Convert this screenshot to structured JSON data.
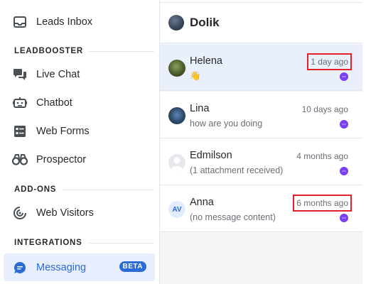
{
  "sidebar": {
    "top_item": {
      "label": "Leads Inbox",
      "icon": "inbox-icon"
    },
    "sections": [
      {
        "heading": "LEADBOOSTER"
      },
      {
        "heading": "ADD-ONS"
      },
      {
        "heading": "INTEGRATIONS"
      }
    ],
    "items": [
      {
        "label": "Live Chat",
        "icon": "chat-bubbles-icon"
      },
      {
        "label": "Chatbot",
        "icon": "bot-icon"
      },
      {
        "label": "Web Forms",
        "icon": "form-icon"
      },
      {
        "label": "Prospector",
        "icon": "binoculars-icon"
      },
      {
        "label": "Web Visitors",
        "icon": "target-icon"
      },
      {
        "label": "Messaging",
        "icon": "message-icon",
        "badge": "BETA",
        "active": true
      }
    ]
  },
  "inbox": {
    "title": "Dolik",
    "conversations": [
      {
        "name": "Helena",
        "preview": "👋",
        "time": "1 day ago",
        "highlighted_time": true,
        "selected": true,
        "channel_icon": "messenger-icon"
      },
      {
        "name": "Lina",
        "preview": "how are you doing",
        "time": "10 days ago",
        "highlighted_time": false,
        "selected": false,
        "channel_icon": "messenger-icon"
      },
      {
        "name": "Edmilson",
        "preview": "(1 attachment received)",
        "time": "4 months ago",
        "highlighted_time": false,
        "selected": false,
        "channel_icon": "messenger-icon"
      },
      {
        "name": "Anna",
        "initials": "AV",
        "preview": "(no message content)",
        "time": "6 months ago",
        "highlighted_time": true,
        "selected": false,
        "channel_icon": "messenger-icon"
      }
    ]
  },
  "colors": {
    "accent": "#2b6bd6",
    "active_bg": "#e7efff",
    "selected_row_bg": "#eaf0fb",
    "highlight_box": "#e0222e",
    "messenger": "#7b3ff2"
  }
}
